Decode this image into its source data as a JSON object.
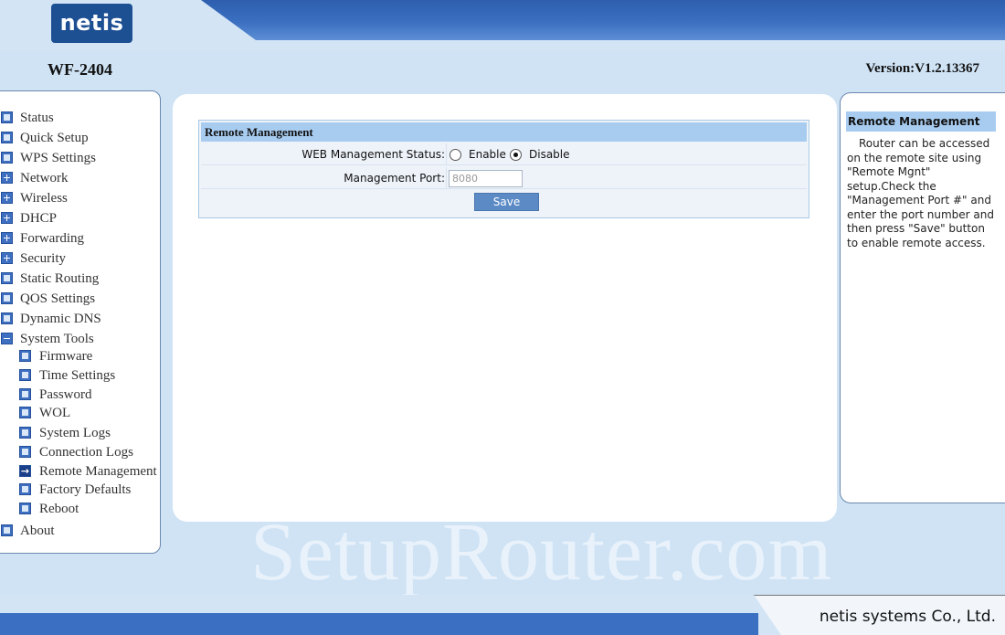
{
  "header": {
    "logo": "netis",
    "model": "WF-2404",
    "version": "Version:V1.2.13367"
  },
  "sidebar": {
    "items": [
      {
        "label": "Status",
        "icon": "page-icon"
      },
      {
        "label": "Quick Setup",
        "icon": "page-icon"
      },
      {
        "label": "WPS Settings",
        "icon": "page-icon"
      },
      {
        "label": "Network",
        "icon": "expand-icon"
      },
      {
        "label": "Wireless",
        "icon": "expand-icon"
      },
      {
        "label": "DHCP",
        "icon": "expand-icon"
      },
      {
        "label": "Forwarding",
        "icon": "expand-icon"
      },
      {
        "label": "Security",
        "icon": "expand-icon"
      },
      {
        "label": "Static Routing",
        "icon": "page-icon"
      },
      {
        "label": "QOS Settings",
        "icon": "page-icon"
      },
      {
        "label": "Dynamic DNS",
        "icon": "page-icon"
      },
      {
        "label": "System Tools",
        "icon": "collapse-icon"
      },
      {
        "label": "About",
        "icon": "page-icon"
      }
    ],
    "subitems": [
      {
        "label": "Firmware",
        "icon": "page-icon"
      },
      {
        "label": "Time Settings",
        "icon": "page-icon"
      },
      {
        "label": "Password",
        "icon": "page-icon"
      },
      {
        "label": "WOL",
        "icon": "page-icon"
      },
      {
        "label": "System Logs",
        "icon": "page-icon"
      },
      {
        "label": "Connection Logs",
        "icon": "page-icon"
      },
      {
        "label": "Remote Management",
        "icon": "arrow-right-icon",
        "selected": true
      },
      {
        "label": "Factory Defaults",
        "icon": "page-icon"
      },
      {
        "label": "Reboot",
        "icon": "page-icon"
      }
    ]
  },
  "main": {
    "section_title": "Remote Management",
    "web_status_label": "WEB Management Status:",
    "enable_label": "Enable",
    "disable_label": "Disable",
    "web_status_selected": "Disable",
    "port_label": "Management Port:",
    "port_value": "8080",
    "save_label": "Save"
  },
  "help": {
    "title": "Remote Management",
    "text": "Router can be accessed on the remote site using \"Remote Mgnt\" setup.Check the \"Management Port #\" and enter the port number and then press \"Save\" button to enable remote access."
  },
  "watermark": "SetupRouter.com",
  "footer": {
    "company": "netis systems Co., Ltd."
  },
  "colors": {
    "brand_blue": "#3b6fc1",
    "title_bar": "#a8ccf0",
    "background": "#cfe3f5"
  }
}
